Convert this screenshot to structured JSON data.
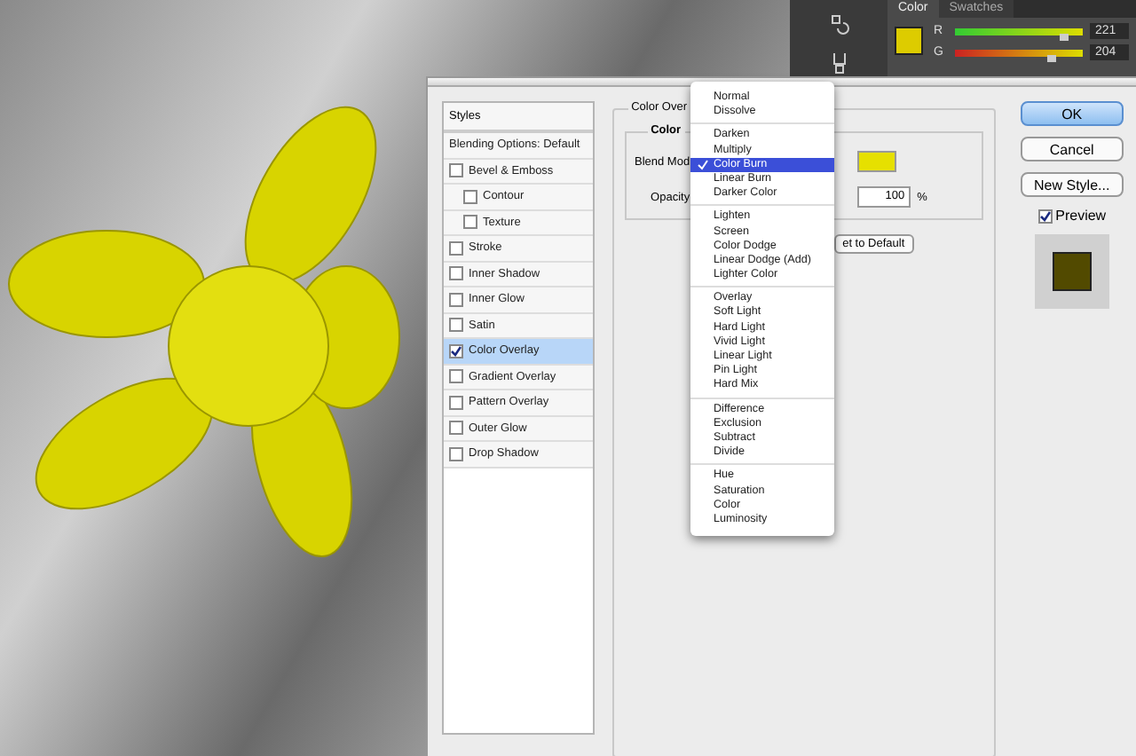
{
  "color_panel": {
    "tabs": [
      {
        "label": "Color",
        "selected": true
      },
      {
        "label": "Swatches",
        "selected": false
      }
    ],
    "channels": [
      {
        "name": "R",
        "value": "221",
        "level": 0.85,
        "kind": "red"
      },
      {
        "name": "G",
        "value": "204",
        "level": 0.75,
        "kind": "green"
      }
    ]
  },
  "dialog": {
    "styles_list": {
      "header": "Styles",
      "blending": "Blending Options: Default",
      "items": [
        {
          "label": "Bevel & Emboss",
          "checked": false,
          "selected": false,
          "children": [
            {
              "label": "Contour",
              "checked": false,
              "selected": false
            },
            {
              "label": "Texture",
              "checked": false,
              "selected": false
            }
          ]
        },
        {
          "label": "Stroke",
          "checked": false,
          "selected": false
        },
        {
          "label": "Inner Shadow",
          "checked": false,
          "selected": false
        },
        {
          "label": "Inner Glow",
          "checked": false,
          "selected": false
        },
        {
          "label": "Satin",
          "checked": false,
          "selected": false
        },
        {
          "label": "Color Overlay",
          "checked": true,
          "selected": true
        },
        {
          "label": "Gradient Overlay",
          "checked": false,
          "selected": false
        },
        {
          "label": "Pattern Overlay",
          "checked": false,
          "selected": false
        },
        {
          "label": "Outer Glow",
          "checked": false,
          "selected": false
        },
        {
          "label": "Drop Shadow",
          "checked": false,
          "selected": false
        }
      ]
    },
    "overlay": {
      "legend": "Color Over",
      "group": "Color",
      "blend_label": "Blend Mod",
      "opacity_label": "Opacity",
      "opacity_value": "100",
      "percent": "%",
      "reset_button": "et to Default"
    },
    "buttons": [
      {
        "label": "OK",
        "kind": "default"
      },
      {
        "label": "Cancel",
        "kind": "normal"
      },
      {
        "label": "New Style...",
        "kind": "normal"
      }
    ],
    "preview": {
      "label": "Preview",
      "checked": true
    }
  },
  "blend_menu": {
    "groups": [
      {
        "items": [
          {
            "label": "Normal",
            "selected": false
          },
          {
            "label": "Dissolve",
            "selected": false
          }
        ]
      },
      {
        "items": [
          {
            "label": "Darken",
            "selected": false
          },
          {
            "label": "Multiply",
            "selected": false
          },
          {
            "label": "Color Burn",
            "selected": true
          },
          {
            "label": "Linear Burn",
            "selected": false
          },
          {
            "label": "Darker Color",
            "selected": false
          }
        ]
      },
      {
        "items": [
          {
            "label": "Lighten",
            "selected": false
          },
          {
            "label": "Screen",
            "selected": false
          },
          {
            "label": "Color Dodge",
            "selected": false
          },
          {
            "label": "Linear Dodge (Add)",
            "selected": false
          },
          {
            "label": "Lighter Color",
            "selected": false
          }
        ]
      },
      {
        "items": [
          {
            "label": "Overlay",
            "selected": false
          },
          {
            "label": "Soft Light",
            "selected": false
          },
          {
            "label": "Hard Light",
            "selected": false
          },
          {
            "label": "Vivid Light",
            "selected": false
          },
          {
            "label": "Linear Light",
            "selected": false
          },
          {
            "label": "Pin Light",
            "selected": false
          },
          {
            "label": "Hard Mix",
            "selected": false
          }
        ]
      },
      {
        "items": [
          {
            "label": "Difference",
            "selected": false
          },
          {
            "label": "Exclusion",
            "selected": false
          },
          {
            "label": "Subtract",
            "selected": false
          },
          {
            "label": "Divide",
            "selected": false
          }
        ]
      },
      {
        "items": [
          {
            "label": "Hue",
            "selected": false
          },
          {
            "label": "Saturation",
            "selected": false
          },
          {
            "label": "Color",
            "selected": false
          },
          {
            "label": "Luminosity",
            "selected": false
          }
        ]
      }
    ]
  }
}
